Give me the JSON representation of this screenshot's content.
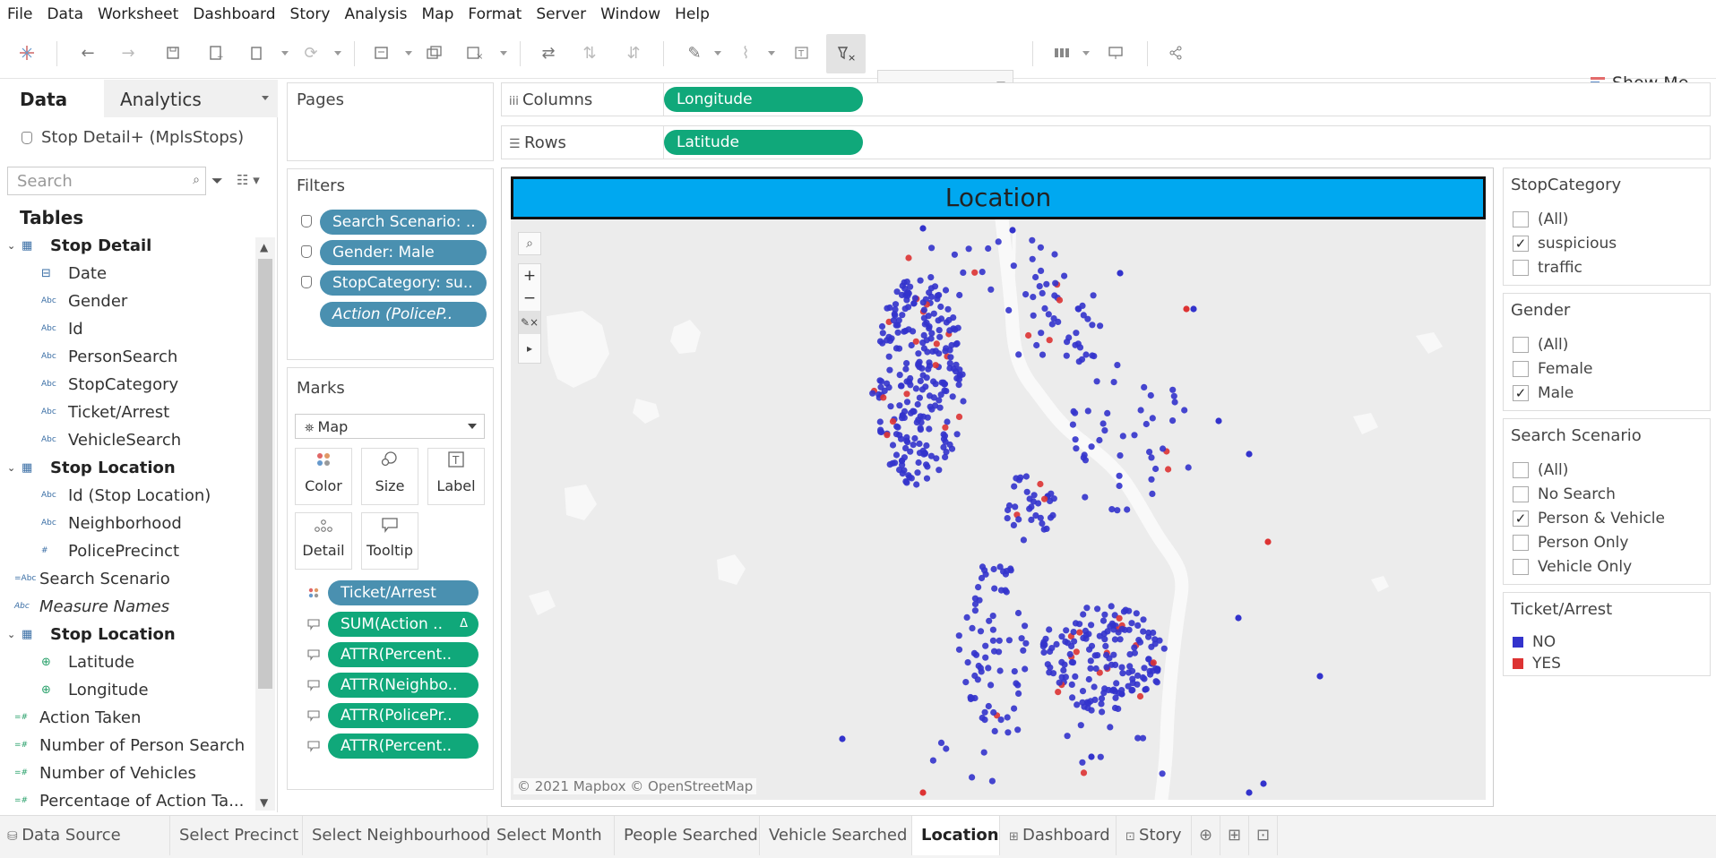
{
  "menu": [
    "File",
    "Data",
    "Worksheet",
    "Dashboard",
    "Story",
    "Analysis",
    "Map",
    "Format",
    "Server",
    "Window",
    "Help"
  ],
  "toolbar": {
    "show_me": "Show Me"
  },
  "left_pane": {
    "tab_data": "Data",
    "tab_analytics": "Analytics",
    "datasource": "Stop Detail+ (MplsStops)",
    "search_placeholder": "Search",
    "tables_label": "Tables",
    "fields": [
      {
        "label": "Stop Detail",
        "kind": "table"
      },
      {
        "label": "Date",
        "kind": "date"
      },
      {
        "label": "Gender",
        "kind": "abc"
      },
      {
        "label": "Id",
        "kind": "abc"
      },
      {
        "label": "PersonSearch",
        "kind": "abc"
      },
      {
        "label": "StopCategory",
        "kind": "abc"
      },
      {
        "label": "Ticket/Arrest",
        "kind": "abc"
      },
      {
        "label": "VehicleSearch",
        "kind": "abc"
      },
      {
        "label": "Stop Location",
        "kind": "table"
      },
      {
        "label": "Id (Stop Location)",
        "kind": "abc"
      },
      {
        "label": "Neighborhood",
        "kind": "abc"
      },
      {
        "label": "PolicePrecinct",
        "kind": "num"
      },
      {
        "label": "Search Scenario",
        "kind": "calc"
      },
      {
        "label": "Measure Names",
        "kind": "abc-ital"
      },
      {
        "label": "Stop Location",
        "kind": "table"
      },
      {
        "label": "Latitude",
        "kind": "geo"
      },
      {
        "label": "Longitude",
        "kind": "geo"
      },
      {
        "label": "Action Taken",
        "kind": "measure"
      },
      {
        "label": "Number of Person Search",
        "kind": "measure"
      },
      {
        "label": "Number of Vehicles",
        "kind": "measure"
      },
      {
        "label": "Percentage of Action Ta...",
        "kind": "measure"
      }
    ]
  },
  "pages": {
    "title": "Pages"
  },
  "filters": {
    "title": "Filters",
    "items": [
      "Search Scenario: ..",
      "Gender: Male",
      "StopCategory: su..",
      "Action (PoliceP.."
    ]
  },
  "marks": {
    "title": "Marks",
    "type": "Map",
    "buttons": [
      "Color",
      "Size",
      "Label",
      "Detail",
      "Tooltip"
    ],
    "pills": [
      "Ticket/Arrest",
      "SUM(Action ..",
      "ATTR(Percent..",
      "ATTR(Neighbo..",
      "ATTR(PolicePr..",
      "ATTR(Percent.."
    ]
  },
  "shelves": {
    "columns_label": "Columns",
    "columns_pill": "Longitude",
    "rows_label": "Rows",
    "rows_pill": "Latitude"
  },
  "view": {
    "title": "Location",
    "attribution": "© 2021 Mapbox © OpenStreetMap",
    "map_controls": {
      "search": "⌕",
      "zoom_in": "+",
      "zoom_out": "−",
      "play": "▸"
    }
  },
  "legends": {
    "stop_category": {
      "title": "StopCategory",
      "options": [
        {
          "label": "(All)",
          "checked": false
        },
        {
          "label": "suspicious",
          "checked": true
        },
        {
          "label": "traffic",
          "checked": false
        }
      ]
    },
    "gender": {
      "title": "Gender",
      "options": [
        {
          "label": "(All)",
          "checked": false
        },
        {
          "label": "Female",
          "checked": false
        },
        {
          "label": "Male",
          "checked": true
        }
      ]
    },
    "search_scenario": {
      "title": "Search Scenario",
      "options": [
        {
          "label": "(All)",
          "checked": false
        },
        {
          "label": "No Search",
          "checked": false
        },
        {
          "label": "Person & Vehicle",
          "checked": true
        },
        {
          "label": "Person Only",
          "checked": false
        },
        {
          "label": "Vehicle Only",
          "checked": false
        }
      ]
    },
    "ticket_arrest": {
      "title": "Ticket/Arrest",
      "items": [
        {
          "label": "NO",
          "color": "#3333cc"
        },
        {
          "label": "YES",
          "color": "#dd3333"
        }
      ]
    }
  },
  "bottom_tabs": [
    {
      "label": "Data Source",
      "icon": "database-icon"
    },
    {
      "label": "Select Precinct"
    },
    {
      "label": "Select Neighbourhood"
    },
    {
      "label": "Select Month"
    },
    {
      "label": "People Searched"
    },
    {
      "label": "Vehicle Searched"
    },
    {
      "label": "Location",
      "active": true
    },
    {
      "label": "Dashboard",
      "icon": "dashboard-icon"
    },
    {
      "label": "Story",
      "icon": "story-icon"
    }
  ],
  "colors": {
    "no": "#3333cc",
    "yes": "#dd3333",
    "pill_blue": "#4a90b0",
    "pill_green": "#10a87a",
    "title_bar": "#00a8f0"
  }
}
